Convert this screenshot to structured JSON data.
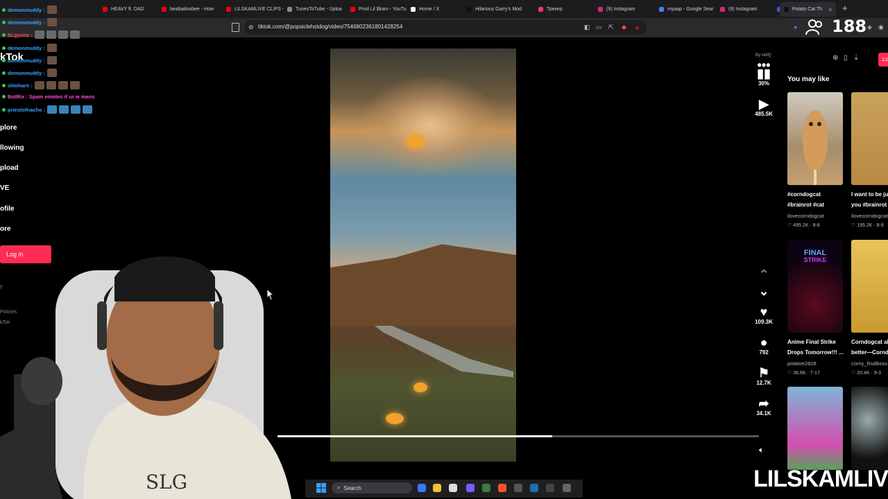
{
  "browser": {
    "tabs": [
      {
        "label": "HEAVY ft. DAD",
        "color": "#ff0000"
      },
      {
        "label": "beabadoobee - How",
        "color": "#ff0000"
      },
      {
        "label": "LILSKAMLIVE CLIPS -",
        "color": "#ff0000"
      },
      {
        "label": "TunesToTube - Uploa",
        "color": "#888888"
      },
      {
        "label": "Prod Lil $kam - YouTu",
        "color": "#ff0000"
      },
      {
        "label": "Home / X",
        "color": "#ffffff"
      },
      {
        "label": "Hilarious Garry's Mod",
        "color": "#111111"
      },
      {
        "label": "Трекер",
        "color": "#ff3366"
      },
      {
        "label": "(9) Instagram",
        "color": "#d62976"
      },
      {
        "label": "myaap - Google Sear",
        "color": "#4285f4"
      },
      {
        "label": "(9) Instagram",
        "color": "#d62976"
      },
      {
        "label": "YTMP3 - YouTube to",
        "color": "#3b5bdb"
      },
      {
        "label": "Potato Cat Th",
        "color": "#111111",
        "active": true
      }
    ],
    "url": "tiktok.com/@popsiclehotdog/video/7546802361801428254"
  },
  "stream": {
    "viewer_count": "188",
    "watermark": "LILSKAMLIVE",
    "chat": [
      {
        "user": "demonmuddy :",
        "color": "#3aa3ff",
        "emotes": 1
      },
      {
        "user": "demonmuddy :",
        "color": "#3aa3ff",
        "emotes": 1
      },
      {
        "user": "bLgyone :",
        "color": "#ff4d4d",
        "emotes": 4
      },
      {
        "user": "demonmuddy :",
        "color": "#3aa3ff",
        "emotes": 1
      },
      {
        "user": "demonmuddy :",
        "color": "#3aa3ff",
        "emotes": 1
      },
      {
        "user": "demonmuddy :",
        "color": "#3aa3ff",
        "emotes": 1
      },
      {
        "user": "slimharn :",
        "color": "#3aa3ff",
        "emotes": 4
      },
      {
        "user": "BotRix : Spam emotes if ur w mans",
        "color": "#ff4dd2",
        "emotes": 0
      },
      {
        "user": "priestofnacho :",
        "color": "#3aa3ff",
        "emotes": 4
      }
    ]
  },
  "tiktok": {
    "logo": "kTok",
    "nav": [
      "plore",
      "llowing",
      "pload",
      "VE",
      "ofile",
      "ore"
    ],
    "login": "Log in",
    "footer": [
      "Policies",
      "kTok"
    ],
    "progress": 0.57,
    "actions": {
      "vidiq": "By vidIQ",
      "percent": "30%",
      "views": "485.5K",
      "likes": "109.3K",
      "comments": "792",
      "saves": "12.7K",
      "shares": "34.1K"
    },
    "sidebar": {
      "login_short": "Lo",
      "heading": "You may like",
      "cards": [
        {
          "title": "#corndogcat #brainrot #cat",
          "user": "ilovecorndogcat",
          "stats": "♡ 495.2K · 8-8"
        },
        {
          "title": "I want to be ju you #brainrot",
          "user": "ilovecorndogcat",
          "stats": "♡ 195.2K · 8-9"
        },
        {
          "title": "Anime Final Strike Drops Tomorrow!!! ...",
          "user": "potatoe2828",
          "stats": "♡ 36.6K · 7-17"
        },
        {
          "title": "Corndogcat al better—Corndo",
          "user": "corny_finalboss",
          "stats": "♡ 20.4K · 9-3"
        }
      ]
    }
  },
  "taskbar": {
    "search": "Search"
  }
}
